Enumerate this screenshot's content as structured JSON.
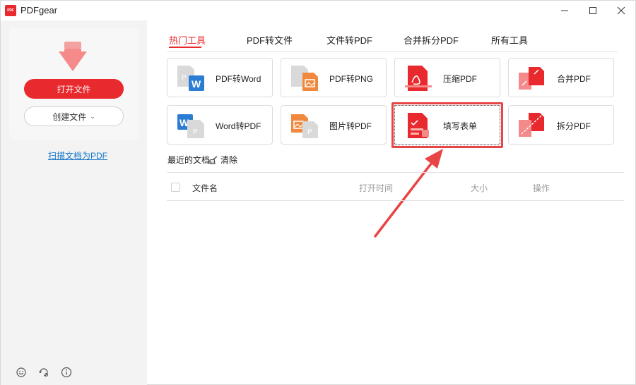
{
  "app": {
    "title": "PDFgear",
    "logo_text": "PDF"
  },
  "sidebar": {
    "open_file": "打开文件",
    "create_file": "创建文件",
    "scan_link": "扫描文档为PDF"
  },
  "tabs": [
    "热门工具",
    "PDF转文件",
    "文件转PDF",
    "合并拆分PDF",
    "所有工具"
  ],
  "tools": [
    {
      "label": "PDF转Word",
      "icon": "pdf-to-word-icon"
    },
    {
      "label": "PDF转PNG",
      "icon": "pdf-to-png-icon"
    },
    {
      "label": "压缩PDF",
      "icon": "compress-pdf-icon"
    },
    {
      "label": "合并PDF",
      "icon": "merge-pdf-icon"
    },
    {
      "label": "Word转PDF",
      "icon": "word-to-pdf-icon"
    },
    {
      "label": "图片转PDF",
      "icon": "image-to-pdf-icon"
    },
    {
      "label": "填写表单",
      "icon": "fill-form-icon"
    },
    {
      "label": "拆分PDF",
      "icon": "split-pdf-icon"
    }
  ],
  "recent": {
    "title": "最近的文档",
    "clear": "清除",
    "columns": {
      "name": "文件名",
      "opened": "打开时间",
      "size": "大小",
      "actions": "操作"
    }
  },
  "colors": {
    "accent": "#e8292d",
    "link": "#1677c9",
    "word_blue": "#2b7cd3",
    "image_orange": "#f0883e"
  }
}
